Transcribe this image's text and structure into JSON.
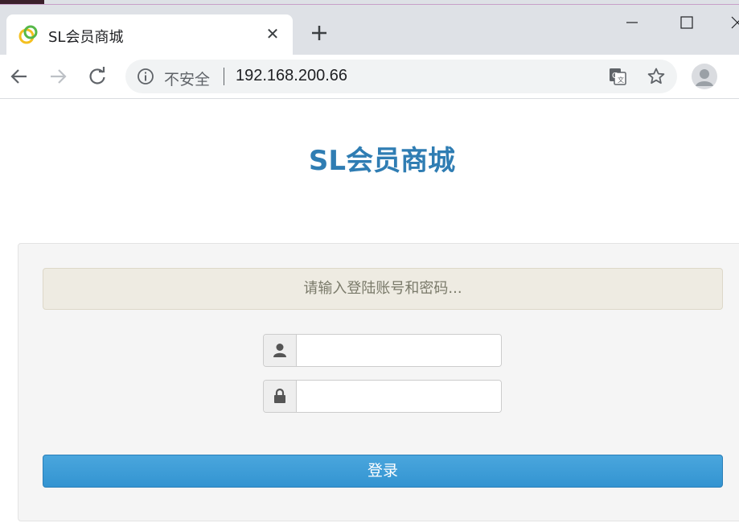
{
  "browser": {
    "tab_title": "SL会员商城",
    "omnibox": {
      "security_label": "不安全",
      "url": "192.168.200.66"
    },
    "icons": [
      "favicon-icon",
      "close-icon",
      "plus-icon",
      "minimize-icon",
      "maximize-icon",
      "window-close-icon",
      "back-icon",
      "forward-icon",
      "reload-icon",
      "info-icon",
      "translate-icon",
      "star-icon",
      "profile-icon"
    ]
  },
  "page": {
    "title": "SL会员商城",
    "alert_text": "请输入登陆账号和密码...",
    "username": {
      "value": "",
      "icon": "user-icon"
    },
    "password": {
      "value": "",
      "icon": "lock-icon"
    },
    "login_label": "登录"
  },
  "colors": {
    "title": "#2f7db3",
    "login_button": "#3a9ad7",
    "alert_bg": "#eeebe2"
  }
}
